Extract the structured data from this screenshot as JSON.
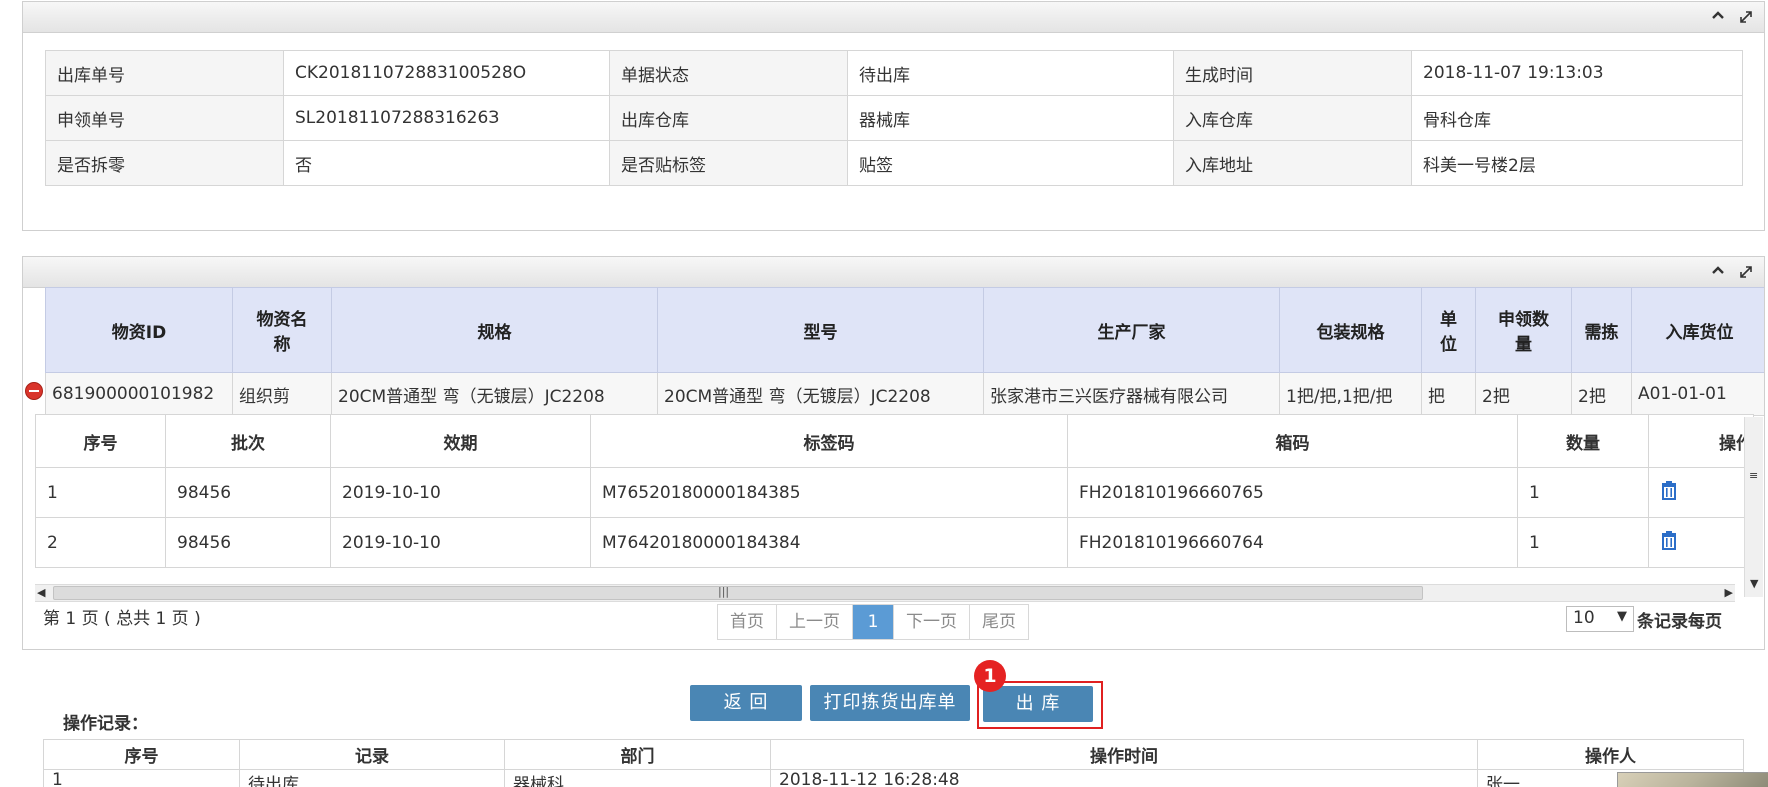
{
  "order_info": {
    "rows": [
      [
        {
          "label": "出库单号",
          "value": "CK201811072883100528O"
        },
        {
          "label": "单据状态",
          "value": "待出库"
        },
        {
          "label": "生成时间",
          "value": "2018-11-07 19:13:03"
        }
      ],
      [
        {
          "label": "申领单号",
          "value": "SL2018110728831626З"
        },
        {
          "label": "出库仓库",
          "value": "器械库"
        },
        {
          "label": "入库仓库",
          "value": "骨科仓库"
        }
      ],
      [
        {
          "label": "是否拆零",
          "value": "否"
        },
        {
          "label": "是否贴标签",
          "value": "贴签"
        },
        {
          "label": "入库地址",
          "value": "科美一号楼2层"
        }
      ]
    ]
  },
  "materials": {
    "headers": [
      "物资ID",
      "物资名称",
      "规格",
      "型号",
      "生产厂家",
      "包装规格",
      "单位",
      "申领数量",
      "需拣",
      "入库货位"
    ],
    "rows": [
      [
        "681900000101982",
        "组织剪",
        "20CM普通型 弯（无镀层）JC2208",
        "20CM普通型 弯（无镀层）JC2208",
        "张家港市三兴医疗器械有限公司",
        "1把/把,1把/把",
        "把",
        "2把",
        "2把",
        "A01-01-01"
      ]
    ]
  },
  "details": {
    "headers": [
      "序号",
      "批次",
      "效期",
      "标签码",
      "箱码",
      "数量",
      "操作"
    ],
    "rows": [
      [
        "1",
        "98456",
        "2019-10-10",
        "M76520180000184385",
        "FH201810196660765",
        "1"
      ],
      [
        "2",
        "98456",
        "2019-10-10",
        "M76420180000184384",
        "FH201810196660764",
        "1"
      ]
    ],
    "delete_icon": "trash-icon"
  },
  "pagination": {
    "summary": "第 1 页 ( 总共 1 页 )",
    "first": "首页",
    "prev": "上一页",
    "current": "1",
    "next": "下一页",
    "last": "尾页",
    "page_size": "10",
    "page_size_suffix": "条记录每页"
  },
  "actions": {
    "back": "返 回",
    "print": "打印拣货出库单",
    "outbound": "出 库",
    "badge": "1",
    "accent": "#4a86b4",
    "highlight": "#e02020"
  },
  "log": {
    "title": "操作记录：",
    "headers": [
      "序号",
      "记录",
      "部门",
      "操作时间",
      "操作人"
    ],
    "rows": [
      [
        "1",
        "待出库",
        "器械科",
        "2018-11-12 16:28:48",
        "张一"
      ]
    ]
  },
  "icons": [
    "collapse-icon",
    "expand-icon",
    "remove-row-icon",
    "trash-icon"
  ]
}
